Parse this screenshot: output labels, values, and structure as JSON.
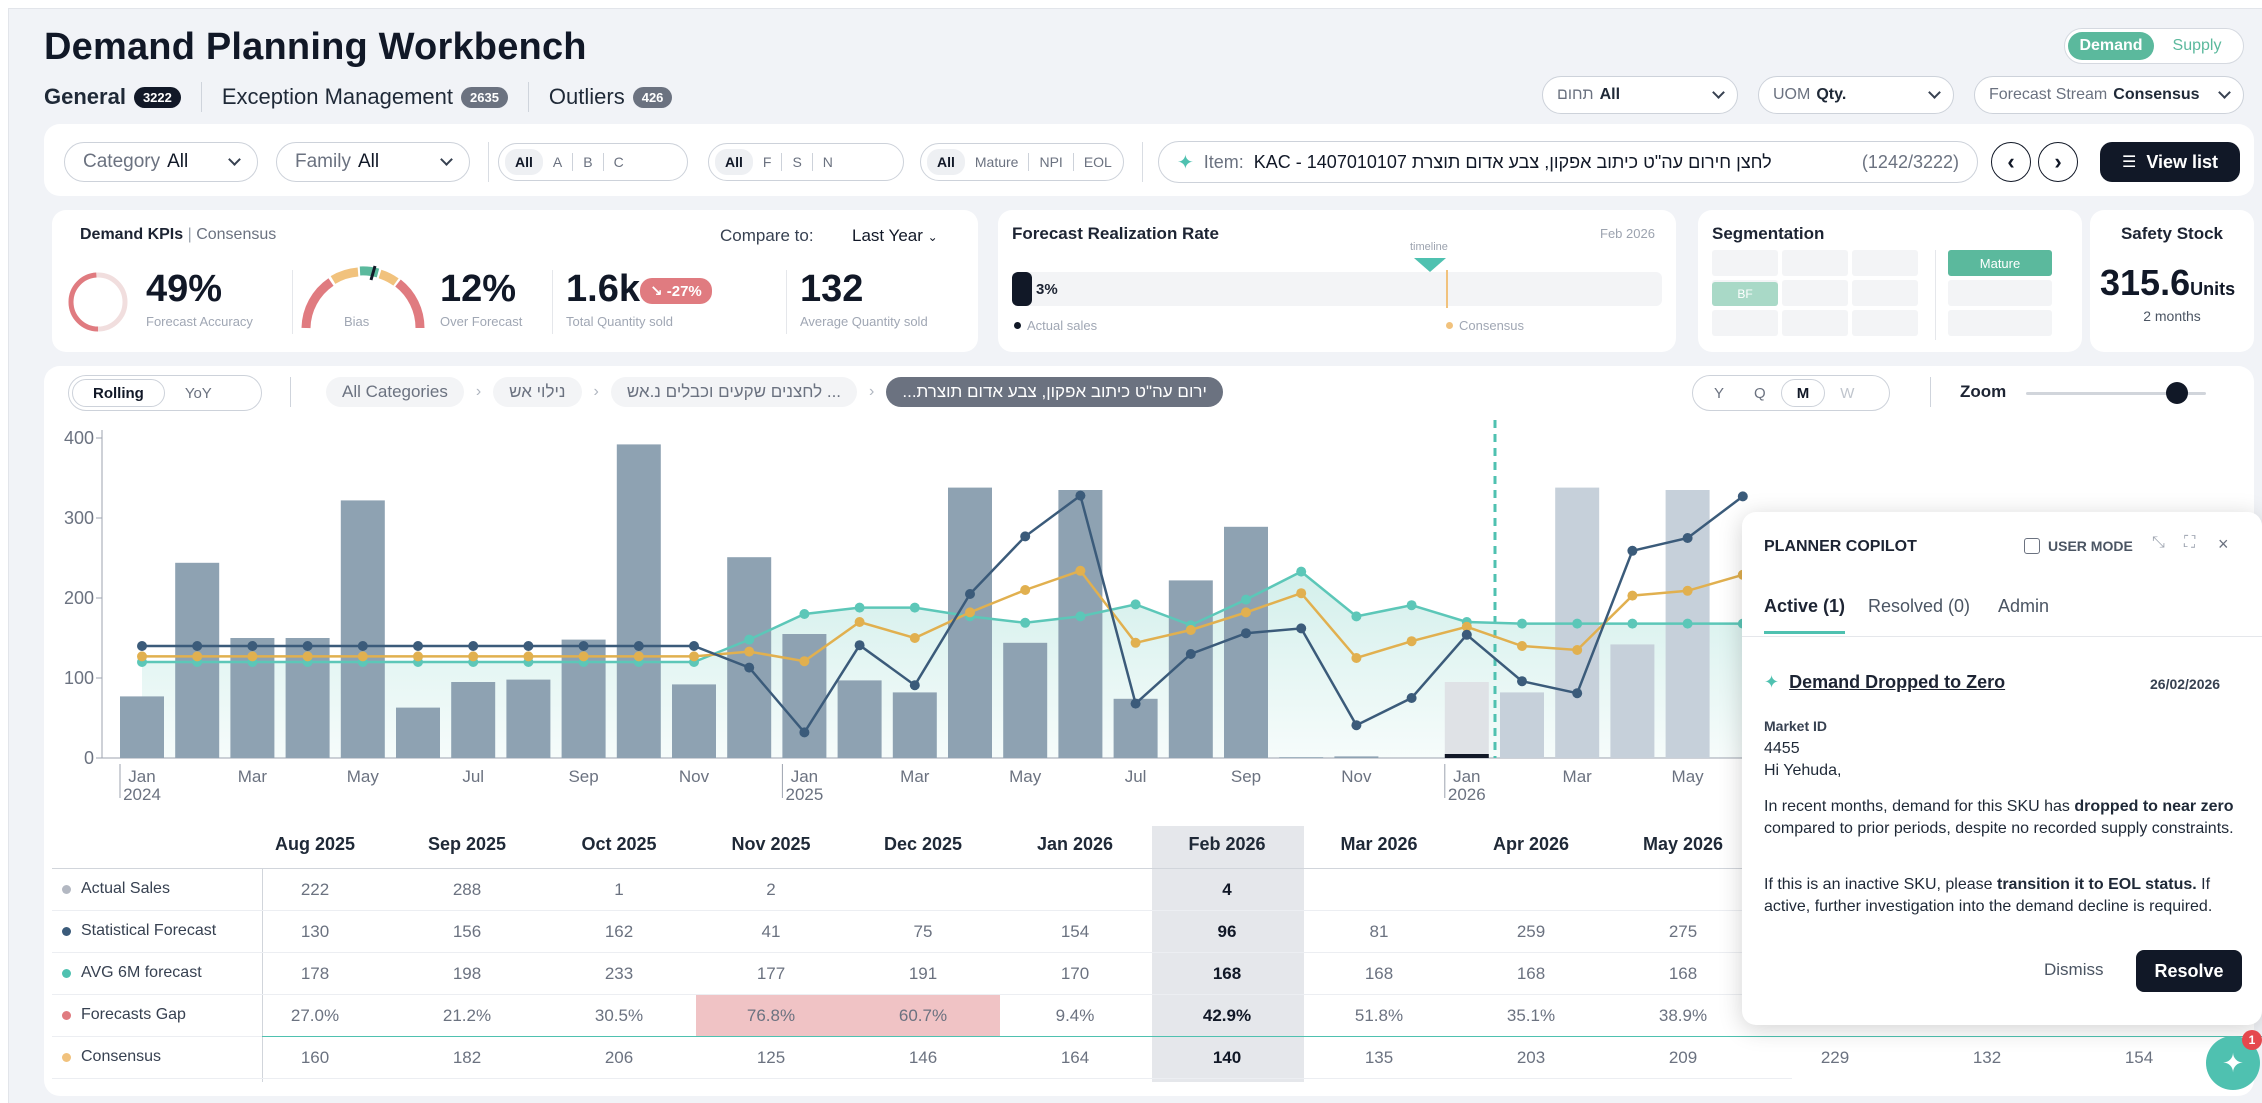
{
  "header": {
    "title": "Demand Planning Workbench",
    "tabs": [
      {
        "label": "General",
        "count": "3222"
      },
      {
        "label": "Exception Management",
        "count": "2635"
      },
      {
        "label": "Outliers",
        "count": "426"
      }
    ],
    "mode_toggle": {
      "demand": "Demand",
      "supply": "Supply"
    },
    "domain_select": {
      "label": "תחום",
      "value": "All"
    },
    "uom_select": {
      "label": "UOM",
      "value": "Qty."
    },
    "stream_select": {
      "label": "Forecast Stream",
      "value": "Consensus"
    }
  },
  "filters": {
    "category": {
      "label": "Category",
      "value": "All"
    },
    "family": {
      "label": "Family",
      "value": "All"
    },
    "abc": [
      "All",
      "A",
      "B",
      "C"
    ],
    "fsn": [
      "All",
      "F",
      "S",
      "N"
    ],
    "lifecycle": [
      "All",
      "Mature",
      "NPI",
      "EOL"
    ],
    "item_label": "Item:",
    "item_value": "KAC - 1407010107 לחצן חירום עה\"ט כיתוב אפקון, צבע אדום תוצרת",
    "item_count": "(1242/3222)",
    "view_list": "View list"
  },
  "kpis": {
    "title": "Demand KPIs",
    "stream": "Consensus",
    "compare_label": "Compare to:",
    "compare_value": "Last Year",
    "accuracy": {
      "value": "49%",
      "label": "Forecast Accuracy"
    },
    "bias": {
      "label": "Bias"
    },
    "over": {
      "value": "12%",
      "label": "Over Forecast"
    },
    "total": {
      "value": "1.6k",
      "change": "-27%",
      "label": "Total Quantity sold"
    },
    "avg": {
      "value": "132",
      "label": "Average Quantity sold"
    }
  },
  "realization": {
    "title": "Forecast Realization Rate",
    "date": "Feb 2026",
    "marker": "timeline",
    "value": "3%",
    "progress": 0.03,
    "legend_actual": "Actual sales",
    "legend_consensus": "Consensus"
  },
  "segmentation": {
    "title": "Segmentation",
    "tag1": "BF",
    "tag2": "Mature"
  },
  "safety": {
    "title": "Safety Stock",
    "value": "315.6",
    "unit": "Units",
    "sub": "2 months"
  },
  "controls": {
    "rolling": "Rolling",
    "yoy": "YoY",
    "crumbs": [
      "All Categories",
      "נילוי אש",
      "לחצנים שקעים וכבלים נ.אש ...",
      "...ירום עה\"ט כיתוב אפקון, צבע אדום תוצרת"
    ],
    "granularity": [
      "Y",
      "Q",
      "M",
      "W"
    ],
    "zoom": "Zoom",
    "zoom_level": 0.84
  },
  "chart_data": {
    "type": "bar",
    "y_ticks": [
      "400",
      "300",
      "200",
      "100",
      "0"
    ],
    "ylim": [
      0,
      400
    ],
    "x_labels": [
      {
        "m": "Jan",
        "y": "2024",
        "i": 0
      },
      {
        "m": "Mar",
        "y": "",
        "i": 2
      },
      {
        "m": "May",
        "y": "",
        "i": 4
      },
      {
        "m": "Jul",
        "y": "",
        "i": 6
      },
      {
        "m": "Sep",
        "y": "",
        "i": 8
      },
      {
        "m": "Nov",
        "y": "",
        "i": 10
      },
      {
        "m": "Jan",
        "y": "2025",
        "i": 12
      },
      {
        "m": "Mar",
        "y": "",
        "i": 14
      },
      {
        "m": "May",
        "y": "",
        "i": 16
      },
      {
        "m": "Jul",
        "y": "",
        "i": 18
      },
      {
        "m": "Sep",
        "y": "",
        "i": 20
      },
      {
        "m": "Nov",
        "y": "",
        "i": 22
      },
      {
        "m": "Jan",
        "y": "2026",
        "i": 24
      },
      {
        "m": "Mar",
        "y": "",
        "i": 26
      },
      {
        "m": "May",
        "y": "",
        "i": 28
      }
    ],
    "actual": [
      77,
      244,
      150,
      150,
      322,
      63,
      95,
      98,
      148,
      392,
      92,
      251,
      155,
      97,
      82,
      338,
      144,
      335,
      74,
      222,
      289,
      1,
      2,
      0,
      0,
      0,
      0,
      0,
      0
    ],
    "future_bars": [
      {
        "i": 24,
        "v": 95
      },
      {
        "i": 25,
        "v": 82
      },
      {
        "i": 26,
        "v": 338
      },
      {
        "i": 27,
        "v": 142
      },
      {
        "i": 28,
        "v": 335
      }
    ],
    "statistical": [
      140,
      140,
      140,
      140,
      140,
      140,
      140,
      140,
      140,
      140,
      140,
      113,
      32,
      141,
      91,
      205,
      277,
      328,
      68,
      130,
      156,
      162,
      41,
      75,
      154,
      96,
      81,
      259,
      275,
      327
    ],
    "avg6m": [
      120,
      120,
      120,
      120,
      120,
      120,
      120,
      120,
      120,
      120,
      120,
      148,
      180,
      188,
      188,
      177,
      169,
      177,
      192,
      166,
      198,
      233,
      177,
      191,
      170,
      168,
      168,
      168,
      168,
      168
    ],
    "consensus": [
      127,
      127,
      127,
      127,
      127,
      127,
      127,
      127,
      127,
      127,
      127,
      133,
      121,
      170,
      150,
      182,
      210,
      234,
      144,
      160,
      182,
      206,
      125,
      146,
      164,
      140,
      135,
      203,
      209,
      229
    ],
    "current_index": 25
  },
  "table": {
    "months": [
      "Aug 2025",
      "Sep 2025",
      "Oct 2025",
      "Nov 2025",
      "Dec 2025",
      "Jan 2026",
      "Feb 2026",
      "Mar 2026",
      "Apr 2026",
      "May 2026"
    ],
    "rows": [
      {
        "label": "Actual Sales",
        "color": "#b3b8c2",
        "cells": [
          "222",
          "288",
          "1",
          "2",
          "",
          "",
          "4",
          "",
          "",
          ""
        ]
      },
      {
        "label": "Statistical Forecast",
        "color": "#3b5b7a",
        "cells": [
          "130",
          "156",
          "162",
          "41",
          "75",
          "154",
          "96",
          "81",
          "259",
          "275"
        ]
      },
      {
        "label": "AVG 6M forecast",
        "color": "#4fc1b0",
        "cells": [
          "178",
          "198",
          "233",
          "177",
          "191",
          "170",
          "168",
          "168",
          "168",
          "168"
        ]
      },
      {
        "label": "Forecasts Gap",
        "color": "#e07b80",
        "cells": [
          "27.0%",
          "21.2%",
          "30.5%",
          "76.8%",
          "60.7%",
          "9.4%",
          "42.9%",
          "51.8%",
          "35.1%",
          "38.9%"
        ]
      },
      {
        "label": "Consensus",
        "color": "#f1c27d",
        "cells": [
          "160",
          "182",
          "206",
          "125",
          "146",
          "164",
          "140",
          "135",
          "203",
          "209",
          "229",
          "132",
          "154"
        ]
      }
    ]
  },
  "copilot": {
    "title": "PLANNER COPILOT",
    "user_mode": "USER MODE",
    "tabs": [
      "Active (1)",
      "Resolved (0)",
      "Admin"
    ],
    "alert": {
      "title": "Demand Dropped to Zero",
      "date": "26/02/2026",
      "market_label": "Market ID",
      "market_value": "4455",
      "greeting": "Hi Yehuda,",
      "p1_a": "In recent months, demand for this SKU has ",
      "p1_b": "dropped to near zero",
      "p1_c": " compared to prior periods, despite no recorded supply constraints.",
      "p2_a": "If this is an inactive SKU, please ",
      "p2_b": "transition it to EOL status.",
      "p2_c": " If active, further investigation into the demand decline is required."
    },
    "dismiss": "Dismiss",
    "resolve": "Resolve",
    "fab_badge": "1"
  }
}
